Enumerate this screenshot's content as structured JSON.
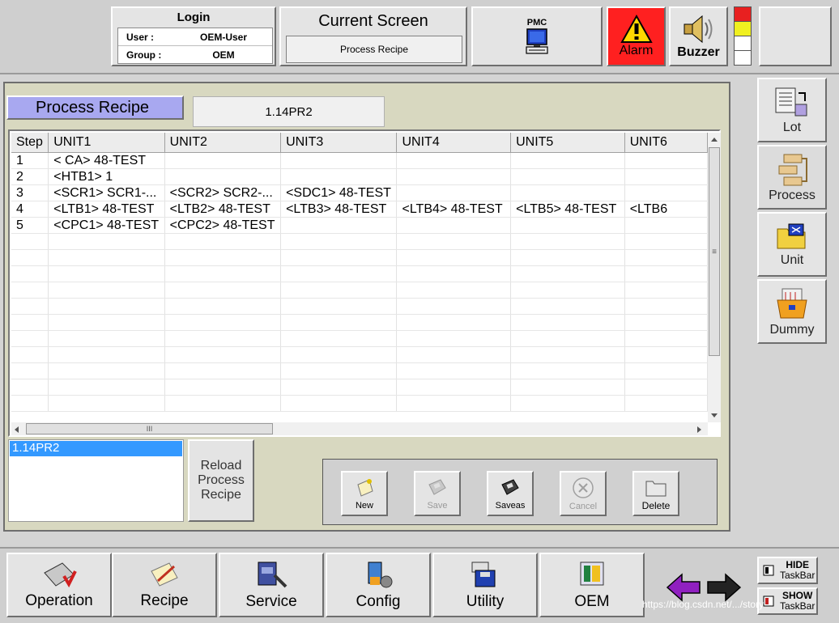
{
  "header": {
    "login": {
      "title": "Login",
      "user_label": "User  :",
      "user_value": "OEM-User",
      "group_label": "Group :",
      "group_value": "OEM"
    },
    "current_screen": {
      "title": "Current Screen",
      "value": "Process Recipe"
    },
    "pmc_label": "PMC",
    "alarm_label": "Alarm",
    "buzzer_label": "Buzzer",
    "status_tower_colors": [
      "#e82020",
      "#f0f020",
      "#ffffff",
      "#ffffff"
    ]
  },
  "panel": {
    "title": "Process Recipe",
    "recipe_name": "1.14PR2",
    "columns": [
      "Step",
      "UNIT1",
      "UNIT2",
      "UNIT3",
      "UNIT4",
      "UNIT5",
      "UNIT6"
    ],
    "rows": [
      [
        "1",
        "<  CA> 48-TEST",
        "",
        "",
        "",
        "",
        ""
      ],
      [
        "2",
        "<HTB1> 1",
        "",
        "",
        "",
        "",
        ""
      ],
      [
        "3",
        "<SCR1> SCR1-...",
        "<SCR2> SCR2-...",
        "<SDC1> 48-TEST",
        "",
        "",
        ""
      ],
      [
        "4",
        "<LTB1> 48-TEST",
        "<LTB2> 48-TEST",
        "<LTB3> 48-TEST",
        "<LTB4> 48-TEST",
        "<LTB5> 48-TEST",
        "<LTB6"
      ],
      [
        "5",
        "<CPC1> 48-TEST",
        "<CPC2> 48-TEST",
        "",
        "",
        "",
        ""
      ],
      [
        "",
        "",
        "",
        "",
        "",
        "",
        ""
      ],
      [
        "",
        "",
        "",
        "",
        "",
        "",
        ""
      ],
      [
        "",
        "",
        "",
        "",
        "",
        "",
        ""
      ],
      [
        "",
        "",
        "",
        "",
        "",
        "",
        ""
      ],
      [
        "",
        "",
        "",
        "",
        "",
        "",
        ""
      ],
      [
        "",
        "",
        "",
        "",
        "",
        "",
        ""
      ],
      [
        "",
        "",
        "",
        "",
        "",
        "",
        ""
      ],
      [
        "",
        "",
        "",
        "",
        "",
        "",
        ""
      ],
      [
        "",
        "",
        "",
        "",
        "",
        "",
        ""
      ],
      [
        "",
        "",
        "",
        "",
        "",
        "",
        ""
      ],
      [
        "",
        "",
        "",
        "",
        "",
        "",
        ""
      ]
    ],
    "hscroll_grip": "III",
    "vscroll_grip": "≡",
    "recipe_list": [
      "1.14PR2"
    ],
    "reload_label": "Reload Process Recipe",
    "actions": [
      {
        "label": "New",
        "enabled": true
      },
      {
        "label": "Save",
        "enabled": false
      },
      {
        "label": "Saveas",
        "enabled": true
      },
      {
        "label": "Cancel",
        "enabled": false
      },
      {
        "label": "Delete",
        "enabled": true
      }
    ]
  },
  "side_nav": [
    "Lot",
    "Process",
    "Unit",
    "Dummy"
  ],
  "bottom_nav": [
    "Operation",
    "Recipe",
    "Service",
    "Config",
    "Utility",
    "OEM"
  ],
  "taskbar": {
    "hide": "HIDE",
    "show": "SHOW",
    "taskbar": "TaskBar"
  },
  "watermark": "https://blog.csdn.net/.../story"
}
